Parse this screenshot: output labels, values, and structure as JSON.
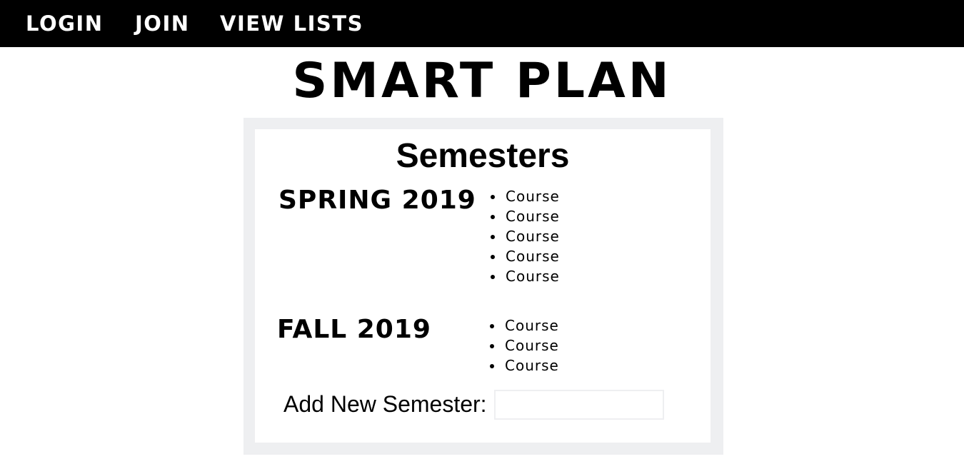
{
  "nav": {
    "login": "LOGIN",
    "join": "JOIN",
    "view_lists": "VIEW LISTS"
  },
  "page_title": "SMART PLAN",
  "semesters_panel": {
    "heading": "Semesters",
    "semesters": [
      {
        "name": "SPRING 2019",
        "courses": [
          "Course",
          "Course",
          "Course",
          "Course",
          "Course"
        ]
      },
      {
        "name": "FALL 2019",
        "courses": [
          "Course",
          "Course",
          "Course"
        ]
      }
    ],
    "add_label": "Add New Semester:",
    "add_input_value": ""
  },
  "colors": {
    "navbar_bg": "#000000",
    "nav_text": "#ffffff",
    "panel_border": "#eeeff1"
  }
}
